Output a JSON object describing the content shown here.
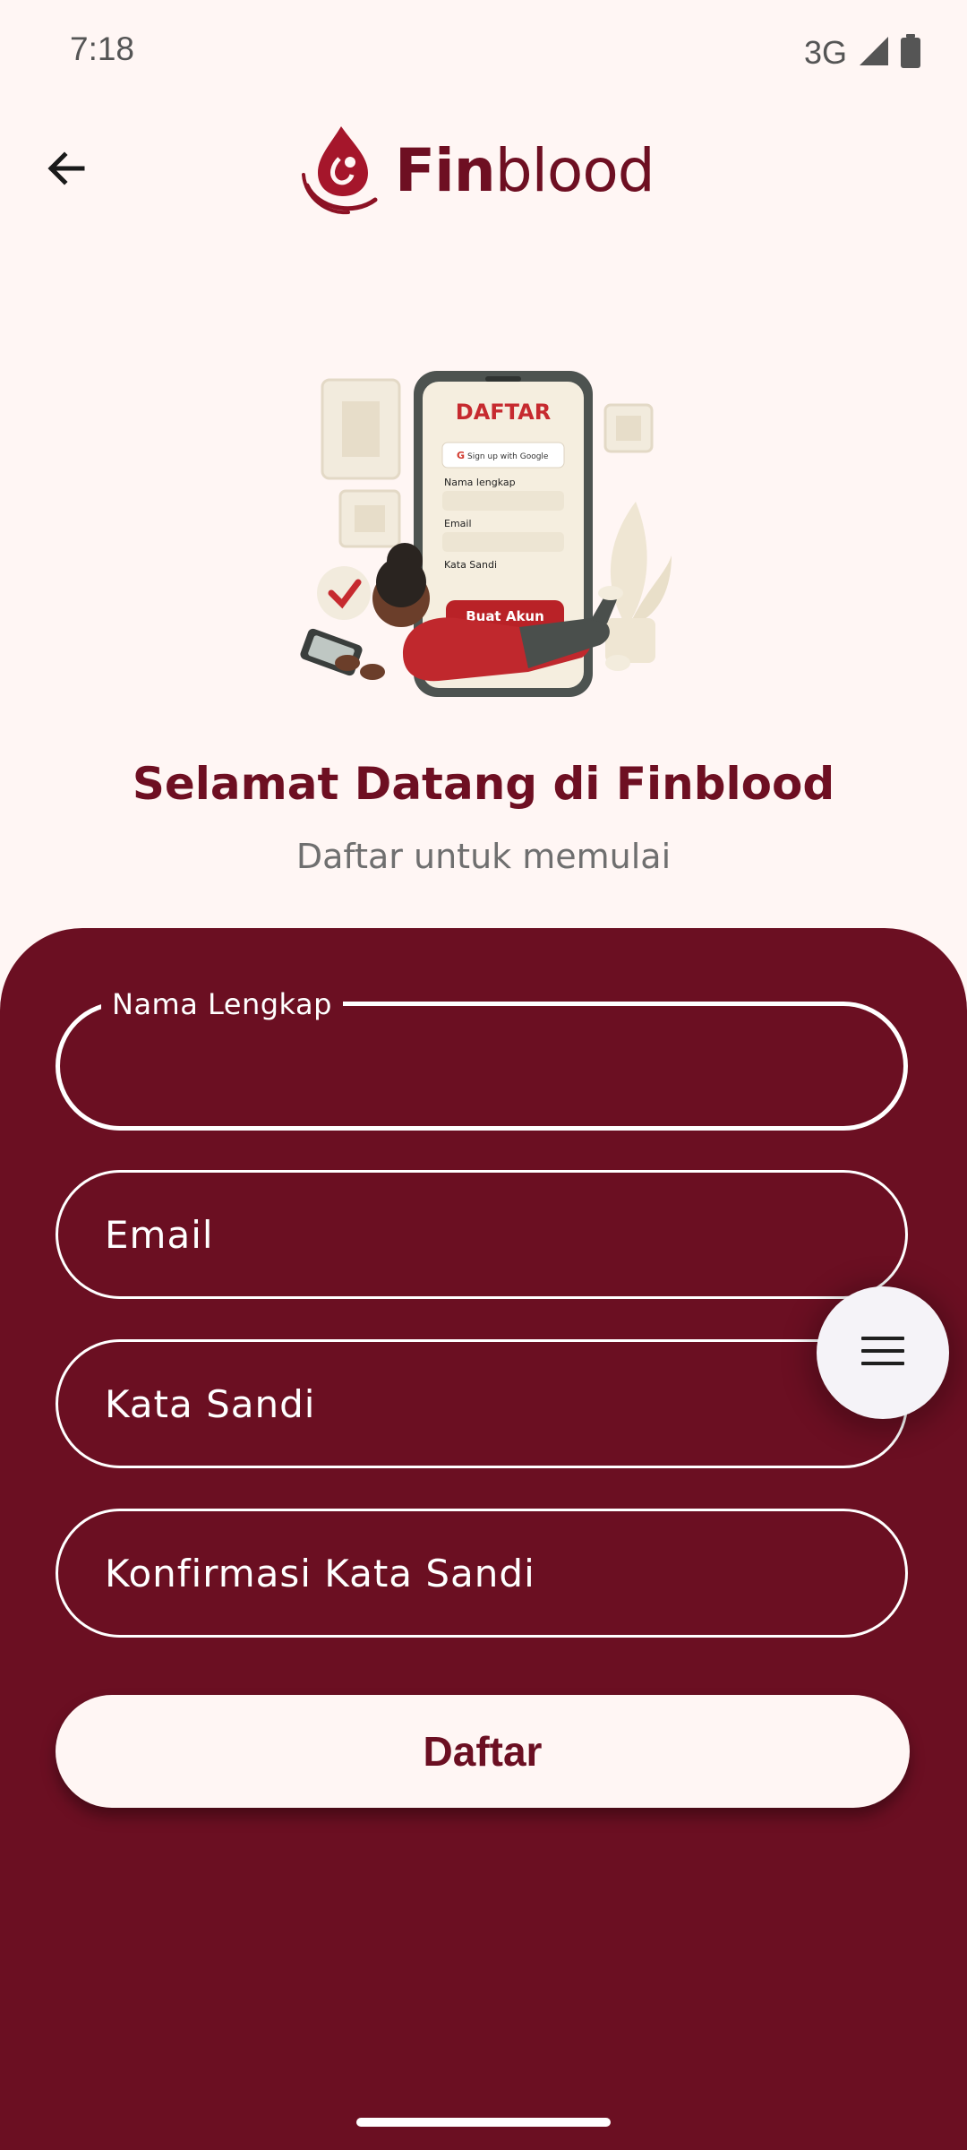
{
  "status_bar": {
    "time": "7:18",
    "network": "3G",
    "icons": [
      "signal-icon",
      "battery-icon"
    ]
  },
  "app_bar": {
    "back_icon": "arrow-left-icon",
    "brand": {
      "name_bold": "Fin",
      "name_light": "blood",
      "logo_icon": "blood-drop-hand-logo",
      "color": "#6E0F22"
    }
  },
  "illustration": {
    "phone_title": "DAFTAR",
    "google_button": "Sign up with Google",
    "field_labels": [
      "Nama lengkap",
      "Email",
      "Kata Sandi"
    ],
    "button": "Buat Akun"
  },
  "welcome": {
    "title": "Selamat Datang di Finblood",
    "subtitle": "Daftar untuk memulai"
  },
  "form": {
    "fields": [
      {
        "label": "Nama Lengkap",
        "value": "",
        "state": "focused"
      },
      {
        "placeholder": "Email",
        "value": ""
      },
      {
        "placeholder": "Kata Sandi",
        "value": ""
      },
      {
        "placeholder": "Konfirmasi Kata Sandi",
        "value": ""
      }
    ],
    "submit_label": "Daftar",
    "panel_color": "#6B0F22"
  },
  "fab": {
    "icon": "menu-icon"
  },
  "colors": {
    "background": "#FFF6F4",
    "accent": "#6E0F22",
    "subtitle": "#6F6F6F"
  }
}
